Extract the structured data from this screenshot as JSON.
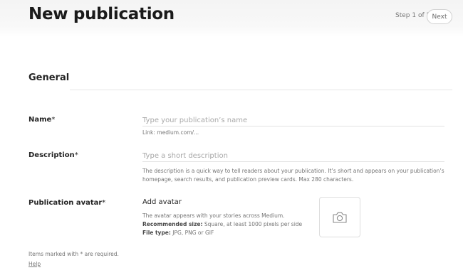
{
  "header": {
    "title": "New publication",
    "step": "Step 1 of 2",
    "next_label": "Next"
  },
  "section": {
    "title": "General"
  },
  "name_field": {
    "label": "Name",
    "required_mark": "*",
    "placeholder": "Type your publication’s name",
    "hint": "Link: medium.com/..."
  },
  "description_field": {
    "label": "Description",
    "required_mark": "*",
    "placeholder": "Type a short description",
    "hint": "The description is a quick way to tell readers about your publication. It’s short and appears on your publication’s homepage, search results, and publication preview cards. Max 280 characters."
  },
  "avatar_field": {
    "label": "Publication avatar",
    "required_mark": "*",
    "title": "Add avatar",
    "info_line": "The avatar appears with your stories across Medium.",
    "size_label": "Recommended size:",
    "size_value": " Square, at least 1000 pixels per side",
    "type_label": "File type:",
    "type_value": " JPG, PNG or GIF",
    "icon": "camera-icon"
  },
  "footer": {
    "required_note": "Items marked with * are required.",
    "help_label": "Help"
  }
}
